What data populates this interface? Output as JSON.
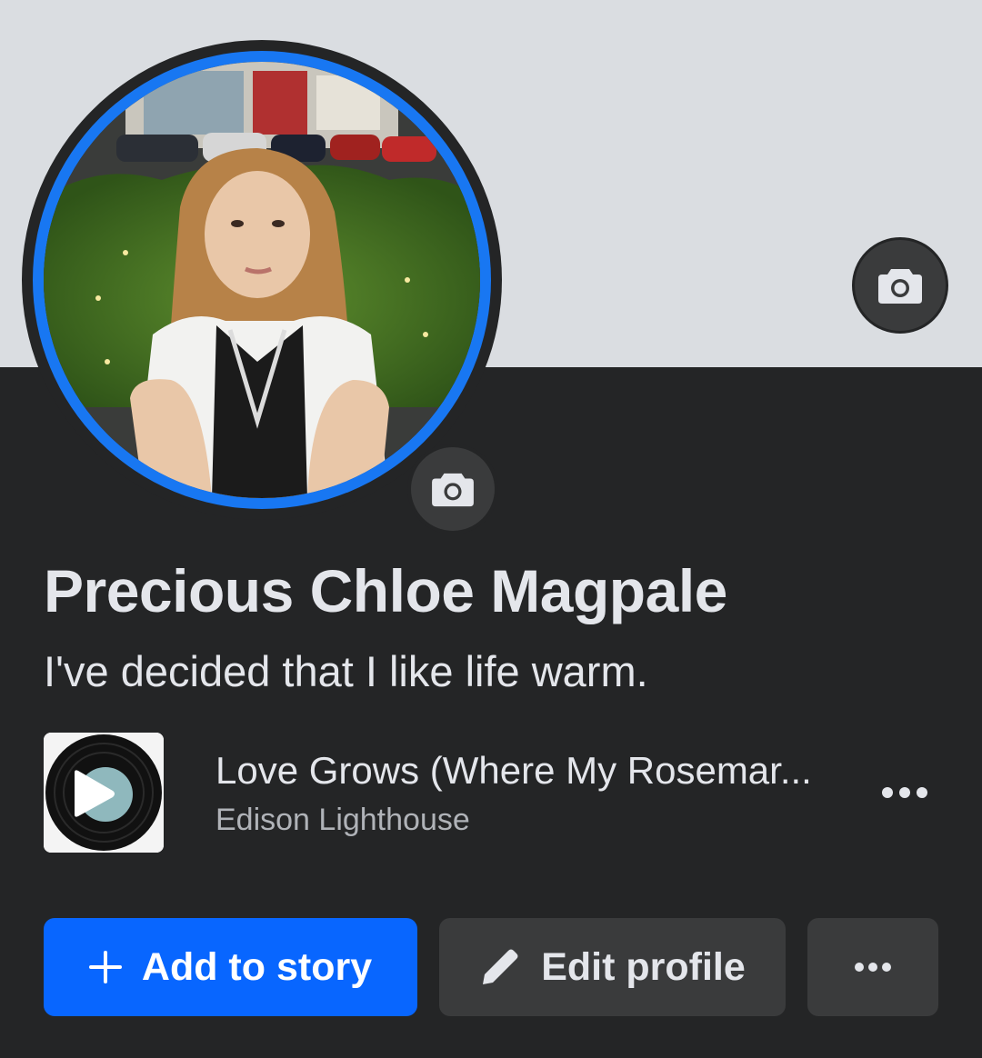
{
  "profile": {
    "name": "Precious Chloe Magpale",
    "bio": "I've decided that I like life warm."
  },
  "music": {
    "title": "Love Grows (Where My Rosemar...",
    "artist": "Edison Lighthouse"
  },
  "actions": {
    "add_story_label": "Add to story",
    "edit_profile_label": "Edit profile"
  },
  "icons": {
    "cover_camera": "camera-icon",
    "avatar_camera": "camera-icon",
    "play": "play-icon",
    "more": "more-horizontal-icon",
    "plus": "plus-icon",
    "pencil": "pencil-icon"
  },
  "colors": {
    "background": "#242526",
    "cover": "#dadde1",
    "accent": "#1877f2",
    "primary_button": "#0866ff",
    "secondary_button": "#3a3b3c",
    "text_primary": "#e4e6eb",
    "text_secondary": "#b0b3b8"
  }
}
